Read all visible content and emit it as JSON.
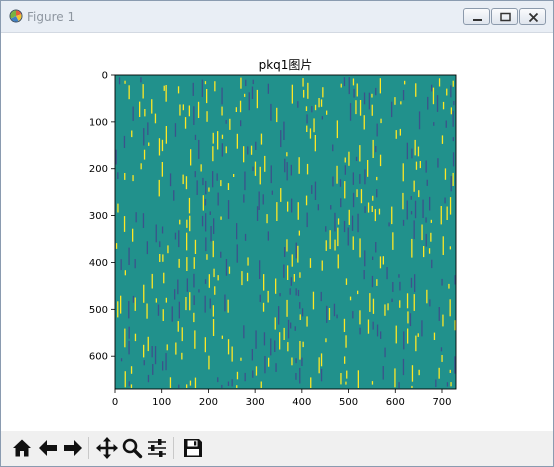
{
  "window": {
    "title": "Figure 1",
    "controls": [
      "minimize",
      "maximize",
      "close"
    ]
  },
  "toolbar": {
    "buttons": [
      {
        "name": "home",
        "icon": "home-icon"
      },
      {
        "name": "back",
        "icon": "arrow-left-icon"
      },
      {
        "name": "forward",
        "icon": "arrow-right-icon"
      },
      {
        "name": "pan",
        "icon": "move-icon"
      },
      {
        "name": "zoom",
        "icon": "magnifier-icon"
      },
      {
        "name": "configure-subplots",
        "icon": "sliders-icon"
      },
      {
        "name": "save",
        "icon": "floppy-disk-icon"
      }
    ]
  },
  "chart_data": {
    "type": "heatmap",
    "title": "pkq1图片",
    "xlabel": "",
    "ylabel": "",
    "xlim": [
      0,
      730
    ],
    "ylim": [
      670,
      0
    ],
    "xticks": [
      "0",
      "100",
      "200",
      "300",
      "400",
      "500",
      "600",
      "700"
    ],
    "yticks": [
      "0",
      "100",
      "200",
      "300",
      "400",
      "500",
      "600"
    ],
    "grid": false,
    "colormap": "viridis",
    "background_color": "#21918c",
    "low_color": "#3b528b",
    "high_color": "#fde725",
    "data_rows": 670,
    "data_cols": 730,
    "description_of_content": "mostly constant field with sparse thin vertical stripes of high and low values"
  }
}
